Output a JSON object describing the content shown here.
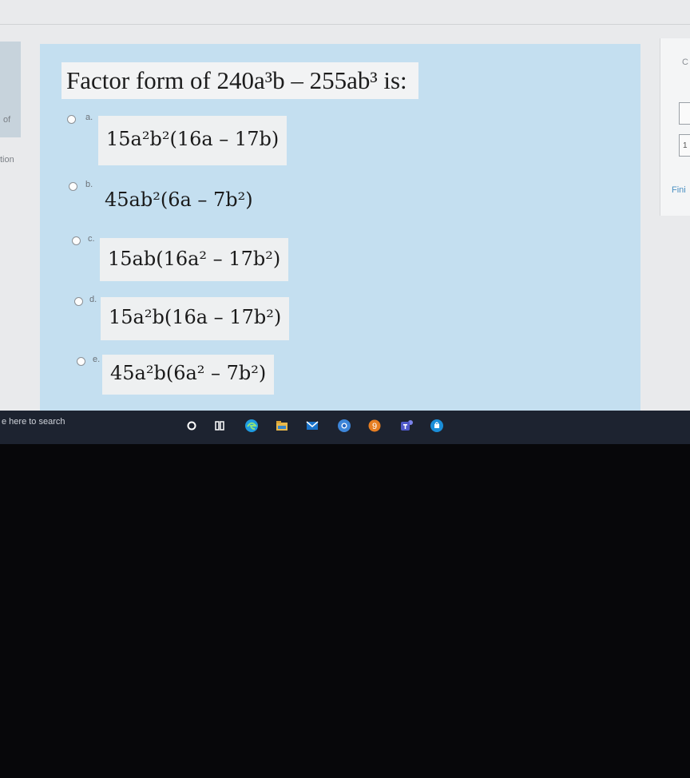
{
  "left_panel": {
    "label_1": "of",
    "label_2": "tion"
  },
  "right_panel": {
    "top_letter": "C",
    "box_value": "1",
    "finish_link": "Fini"
  },
  "question": {
    "text": "Factor form of 240a³b – 255ab³ is:"
  },
  "options": [
    {
      "letter": "a.",
      "answer": "15a²b²(16a – 17b)"
    },
    {
      "letter": "b.",
      "answer": "45ab²(6a – 7b²)"
    },
    {
      "letter": "c.",
      "answer": "15ab(16a² – 17b²)"
    },
    {
      "letter": "d.",
      "answer": "15a²b(16a – 17b²)"
    },
    {
      "letter": "e.",
      "answer": "45a²b(6a² – 7b²)"
    }
  ],
  "taskbar": {
    "search_placeholder": "e here to search",
    "icons": [
      "cortana-icon",
      "task-view-icon",
      "edge-icon",
      "file-explorer-icon",
      "mail-icon",
      "chrome-icon",
      "app-icon",
      "teams-icon",
      "store-icon"
    ]
  }
}
